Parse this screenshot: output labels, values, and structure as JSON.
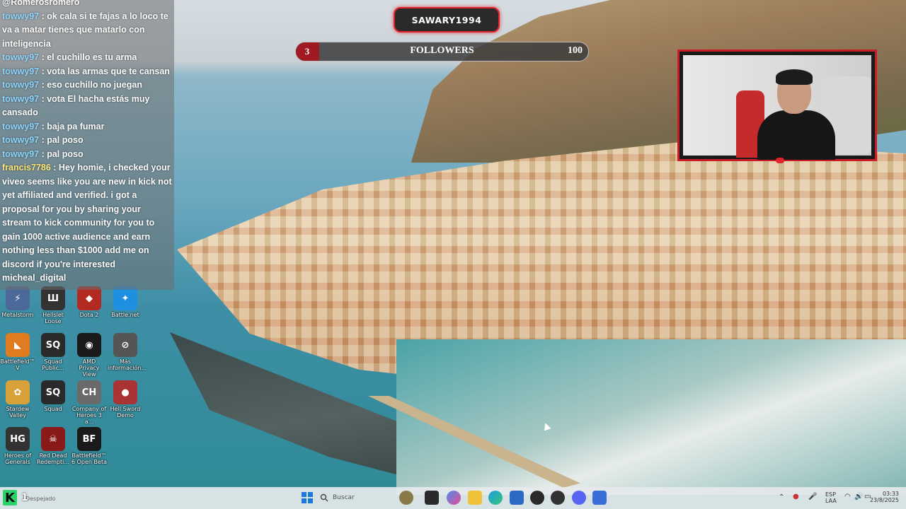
{
  "chat": {
    "lines": [
      {
        "user": "@Romerosromero",
        "msg": ""
      },
      {
        "user": "towwy97",
        "msg": " : ok cala si te fajas a lo loco te va a matar tienes que matarlo con inteligencia"
      },
      {
        "user": "towwy97",
        "msg": " : el cuchillo es tu arma"
      },
      {
        "user": "towwy97",
        "msg": " : vota las armas que te cansan"
      },
      {
        "user": "towwy97",
        "msg": " : eso cuchillo no juegan"
      },
      {
        "user": "towwy97",
        "msg": " : vota El hacha estás muy cansado"
      },
      {
        "user": "towwy97",
        "msg": " : baja pa fumar"
      },
      {
        "user": "towwy97",
        "msg": " : pal poso"
      },
      {
        "user": "towwy97",
        "msg": " : pal poso"
      },
      {
        "user": "francis7786",
        "msg": " : Hey homie, i checked your viveo seems like you are new in kick not yet affiliated and verified. i got a proposal for you by sharing your stream to kick community for you to gain 1000 active audience and earn nothing less than $1000 add me on discord if you're interested micheal_digital"
      }
    ]
  },
  "overlay": {
    "channel_name": "SAWARY1994",
    "followers": {
      "label": "FOLLOWERS",
      "current": "3",
      "goal": "100",
      "progress": 0.03
    }
  },
  "desktop_icons": [
    {
      "label": "Metalstorm",
      "icon": "metalstorm-icon",
      "color": "#4b6a9a"
    },
    {
      "label": "Hellslet Loose",
      "icon": "hell-let-loose-icon",
      "color": "#333333"
    },
    {
      "label": "Dota 2",
      "icon": "dota2-icon",
      "color": "#b22a22"
    },
    {
      "label": "Battle.net",
      "icon": "battlenet-icon",
      "color": "#1f8fe0"
    },
    {
      "label": "Battlefield™ V",
      "icon": "battlefield-v-icon",
      "color": "#e07b20"
    },
    {
      "label": "Squad Public...",
      "icon": "squad-public-icon",
      "color": "#2a2a2a"
    },
    {
      "label": "AMD Privacy View",
      "icon": "amd-privacy-icon",
      "color": "#1a1a1a"
    },
    {
      "label": "Más información...",
      "icon": "info-icon",
      "color": "#555555"
    },
    {
      "label": "Stardew Valley",
      "icon": "stardew-icon",
      "color": "#d9a13a"
    },
    {
      "label": "Squad",
      "icon": "squad-icon",
      "color": "#2a2a2a"
    },
    {
      "label": "Company of Heroes 3 a...",
      "icon": "company-of-heroes-icon",
      "color": "#6a6a6a"
    },
    {
      "label": "Hell Sword Demo",
      "icon": "hell-sword-icon",
      "color": "#a33"
    },
    {
      "label": "Heroes of Generals",
      "icon": "heroes-generals-icon",
      "color": "#333333"
    },
    {
      "label": "Red Dead Redempti...",
      "icon": "red-dead-icon",
      "color": "#8a1a1a"
    },
    {
      "label": "Battlefield™ 6 Open Beta",
      "icon": "battlefield-6-icon",
      "color": "#1a1a1a"
    }
  ],
  "desktop_icons_glyphs": [
    "⚡",
    "Ш",
    "◆",
    "✦",
    "◣",
    "SQ",
    "◉",
    "⊘",
    "✿",
    "SQ",
    "CH",
    "●",
    "HG",
    "☠",
    "BF"
  ],
  "taskbar": {
    "search_placeholder": "Buscar",
    "lang_top": "ESP",
    "lang_bottom": "LAA",
    "time": "03:33",
    "date": "23/8/2025",
    "left_label": "Despejado"
  },
  "kick": {
    "count": "1"
  }
}
